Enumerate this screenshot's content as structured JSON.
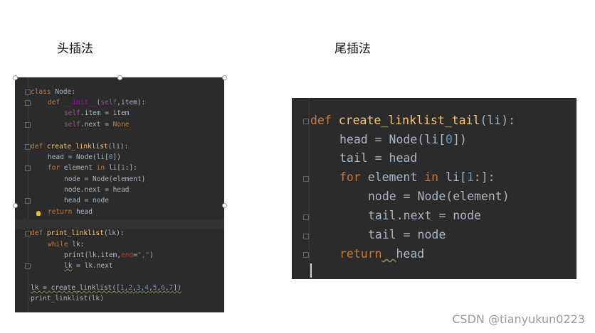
{
  "labels": {
    "left": "头插法",
    "right": "尾插法"
  },
  "left_code": {
    "lines": [
      "class Node:",
      "def __init__(self,item):",
      "self.item = item",
      "self.next = None",
      "",
      "def create_linklist(li):",
      "head = Node(li[0])",
      "for element in li[1:]:",
      "node = Node(element)",
      "node.next = head",
      "head = node",
      "return head",
      "",
      "def print_linklist(lk):",
      "while lk:",
      "print(lk.item,end=\",\")",
      "lk = lk.next",
      "",
      "lk = create_linklist([1,2,3,4,5,6,7])",
      "print_linklist(lk)"
    ]
  },
  "right_code": {
    "lines": [
      "def create_linklist_tail(li):",
      "head = Node(li[0])",
      "tail = head",
      "for element in li[1:]:",
      "node = Node(element)",
      "tail.next = node",
      "tail = node",
      "return  head"
    ]
  },
  "watermark": "CSDN @tianyukun0223"
}
